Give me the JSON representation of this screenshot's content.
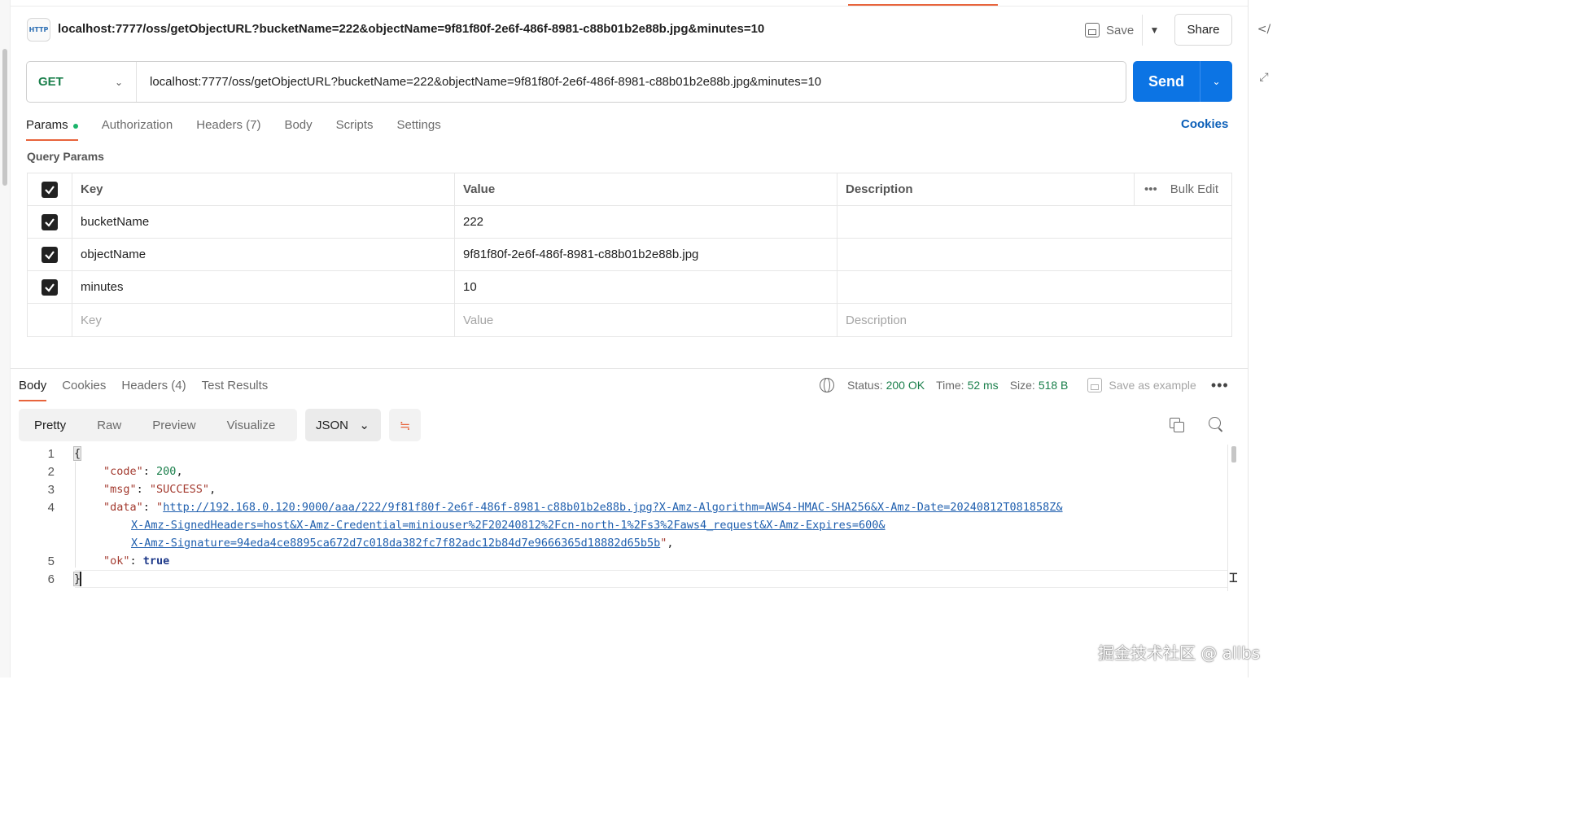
{
  "request": {
    "badge": "HTTP",
    "title": "localhost:7777/oss/getObjectURL?bucketName=222&objectName=9f81f80f-2e6f-486f-8981-c88b01b2e88b.jpg&minutes=10",
    "save_label": "Save",
    "share_label": "Share",
    "method": "GET",
    "url": "localhost:7777/oss/getObjectURL?bucketName=222&objectName=9f81f80f-2e6f-486f-8981-c88b01b2e88b.jpg&minutes=10",
    "send_label": "Send"
  },
  "request_tabs": [
    {
      "label": "Params",
      "active": true
    },
    {
      "label": "Authorization"
    },
    {
      "label": "Headers (7)"
    },
    {
      "label": "Body"
    },
    {
      "label": "Scripts"
    },
    {
      "label": "Settings"
    }
  ],
  "cookies_label": "Cookies",
  "query_params": {
    "title": "Query Params",
    "headers": {
      "key": "Key",
      "value": "Value",
      "description": "Description",
      "bulk_edit": "Bulk Edit"
    },
    "rows": [
      {
        "key": "bucketName",
        "value": "222",
        "description": ""
      },
      {
        "key": "objectName",
        "value": "9f81f80f-2e6f-486f-8981-c88b01b2e88b.jpg",
        "description": ""
      },
      {
        "key": "minutes",
        "value": "10",
        "description": ""
      }
    ],
    "placeholders": {
      "key": "Key",
      "value": "Value",
      "description": "Description"
    }
  },
  "response_tabs": [
    {
      "label": "Body",
      "active": true
    },
    {
      "label": "Cookies"
    },
    {
      "label": "Headers (4)"
    },
    {
      "label": "Test Results"
    }
  ],
  "status": {
    "status_label": "Status:",
    "status_value": "200 OK",
    "time_label": "Time:",
    "time_value": "52 ms",
    "size_label": "Size:",
    "size_value": "518 B",
    "save_example": "Save as example"
  },
  "view_modes": [
    "Pretty",
    "Raw",
    "Preview",
    "Visualize"
  ],
  "format": "JSON",
  "code": {
    "line_numbers": [
      "1",
      "2",
      "3",
      "4",
      "5",
      "6"
    ],
    "open_brace": "{",
    "close_brace": "}",
    "code_key": "\"code\"",
    "code_value": "200",
    "msg_key": "\"msg\"",
    "msg_value": "\"SUCCESS\"",
    "data_key": "\"data\"",
    "data_line1": "http://192.168.0.120:9000/aaa/222/9f81f80f-2e6f-486f-8981-c88b01b2e88b.jpg?X-Amz-Algorithm=AWS4-HMAC-SHA256&X-Amz-Date=20240812T081858Z&",
    "data_line2": "X-Amz-SignedHeaders=host&X-Amz-Credential=miniouser%2F20240812%2Fcn-north-1%2Fs3%2Faws4_request&X-Amz-Expires=600&",
    "data_line3": "X-Amz-Signature=94eda4ce8895ca672d7c018da382fc7f82adc12b84d7e9666365d18882d65b5b",
    "ok_key": "\"ok\"",
    "ok_value": "true"
  },
  "watermark": "掘金技术社区 @ allbs",
  "colors": {
    "accent": "#e8643c",
    "send": "#0c74e4",
    "success": "#1a7f4b",
    "link": "#0b5fb8"
  }
}
